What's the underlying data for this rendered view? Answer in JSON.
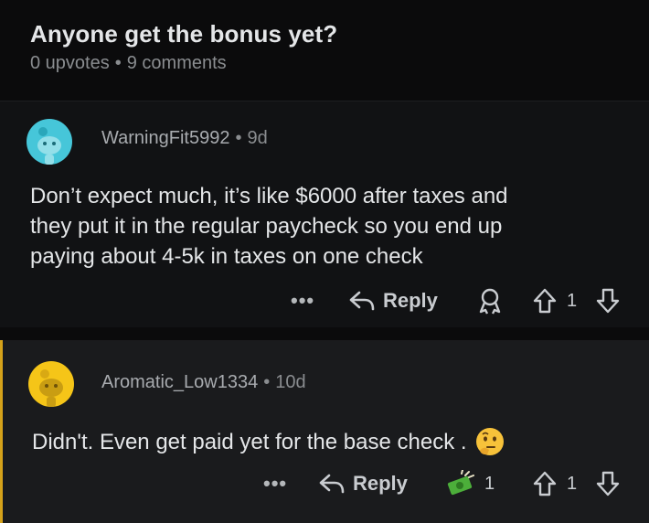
{
  "post": {
    "title": "Anyone get the bonus yet?",
    "upvotes": "0 upvotes",
    "separator": "•",
    "comments": "9 comments"
  },
  "comments": [
    {
      "username": "WarningFit5992",
      "separator": "•",
      "age": "9d",
      "body_lines": [
        "Don’t expect much, it’s like $6000 after taxes and",
        "they put it in the regular paycheck so you end up",
        "paying about 4-5k in taxes on one check"
      ],
      "more_label": "•••",
      "reply_label": "Reply",
      "vote_count": "1",
      "avatar_color": "#46c6d9"
    },
    {
      "username": "Aromatic_Low1334",
      "separator": "•",
      "age": "10d",
      "body": "Didn't. Even get paid yet for the base check .",
      "more_label": "•••",
      "reply_label": "Reply",
      "award_count": "1",
      "vote_count": "1",
      "avatar_color": "#f5c518",
      "thread_color": "#d5a21a"
    }
  ],
  "icons": {
    "award": "award-icon",
    "upvote": "upvote-arrow-icon",
    "downvote": "downvote-arrow-icon",
    "reply": "reply-arrow-icon",
    "money_award": "money-award-icon",
    "thinking_emoji": "thinking-face-icon"
  }
}
